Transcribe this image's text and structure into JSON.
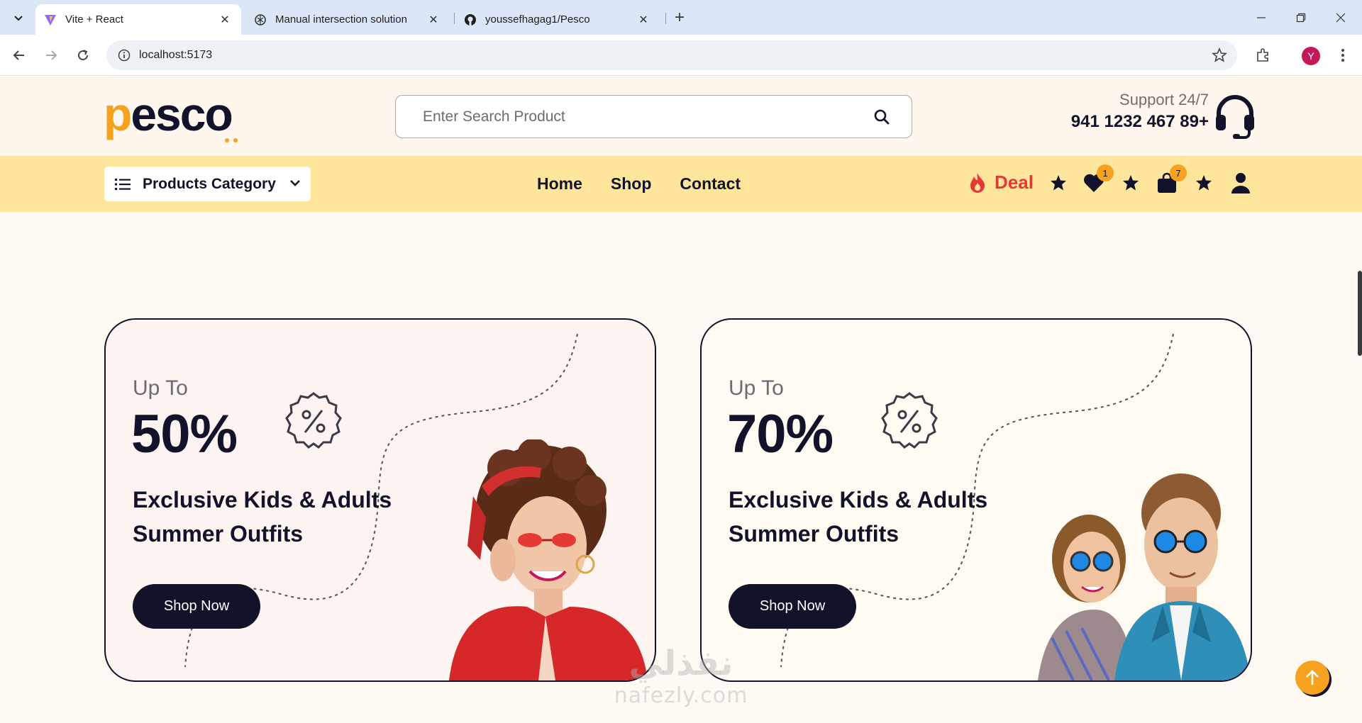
{
  "browser": {
    "tabs": [
      {
        "title": "Vite + React",
        "favicon": "vite-icon",
        "active": true
      },
      {
        "title": "Manual intersection solution",
        "favicon": "openai-icon",
        "active": false
      },
      {
        "title": "youssefhagag1/Pesco",
        "favicon": "github-icon",
        "active": false
      }
    ],
    "url": "localhost:5173",
    "profile_initial": "Y"
  },
  "header": {
    "logo_text_p": "p",
    "logo_text_rest": "esco",
    "search_placeholder": "Enter Search Product",
    "support_label": "Support 24/7",
    "support_phone": "941 1232 467 89+"
  },
  "nav": {
    "category_label": "Products Category",
    "links": [
      "Home",
      "Shop",
      "Contact"
    ],
    "deal_label": "Deal",
    "wishlist_count": "1",
    "cart_count": "7"
  },
  "promos": [
    {
      "up_to": "Up To",
      "percent": "50%",
      "line1": "Exclusive Kids & Adults",
      "line2": "Summer Outfits",
      "button": "Shop Now"
    },
    {
      "up_to": "Up To",
      "percent": "70%",
      "line1": "Exclusive Kids & Adults",
      "line2": "Summer Outfits",
      "button": "Shop Now"
    }
  ],
  "watermark": {
    "arabic": "نفذلي",
    "latin": "nafezly.com"
  },
  "colors": {
    "accent": "#f6a21e",
    "navy": "#12122a",
    "nav_yellow": "#fde69b",
    "deal_red": "#e53935"
  }
}
